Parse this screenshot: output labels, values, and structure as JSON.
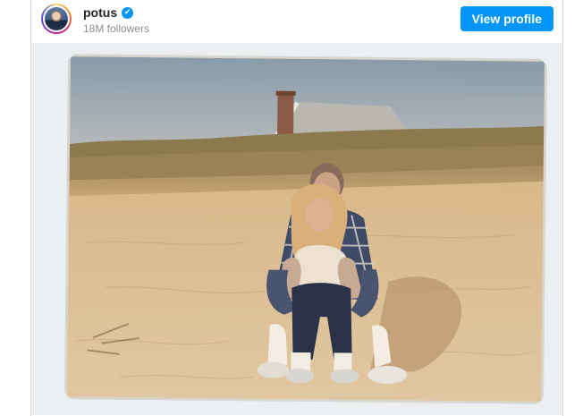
{
  "post": {
    "username": "potus",
    "followers": "18M followers",
    "verified_icon": "✔",
    "view_profile_label": "View profile"
  },
  "colors": {
    "brand_blue": "#0095f6",
    "text_primary": "#262626",
    "text_secondary": "#8e8e8e"
  }
}
